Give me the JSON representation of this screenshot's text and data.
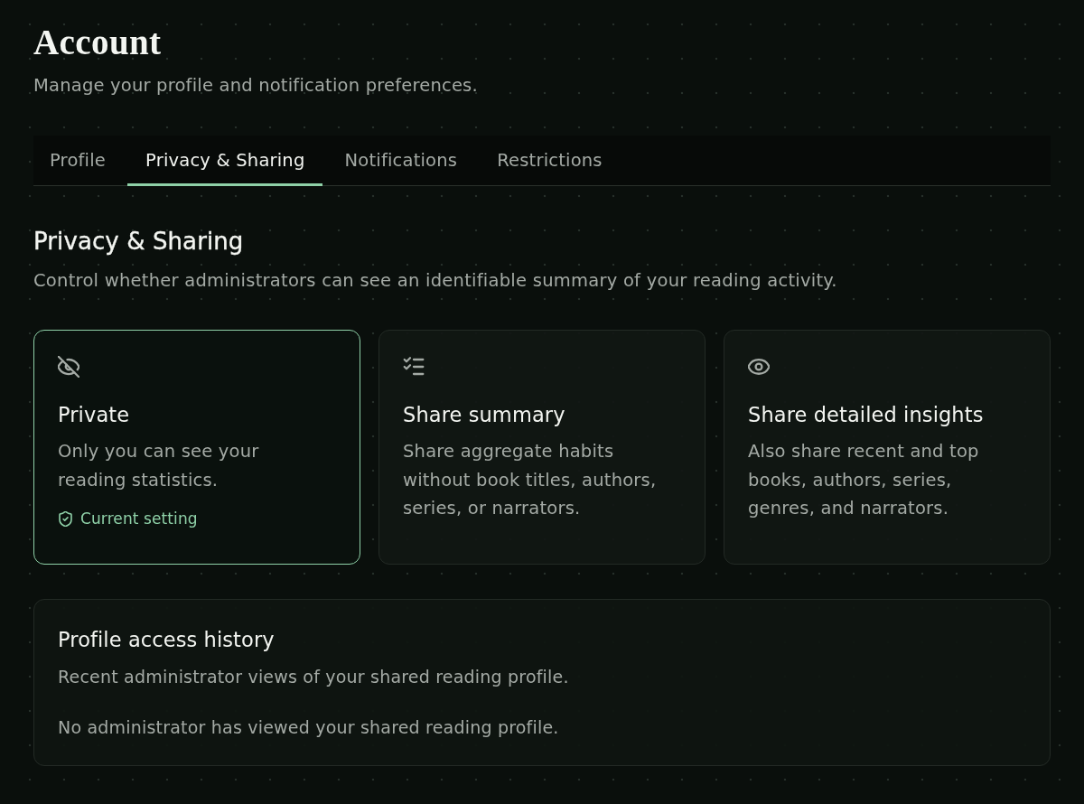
{
  "page": {
    "title": "Account",
    "subtitle": "Manage your profile and notification preferences."
  },
  "tabs": [
    {
      "label": "Profile",
      "selected": false
    },
    {
      "label": "Privacy & Sharing",
      "selected": true
    },
    {
      "label": "Notifications",
      "selected": false
    },
    {
      "label": "Restrictions",
      "selected": false
    }
  ],
  "section": {
    "title": "Privacy & Sharing",
    "description": "Control whether administrators can see an identifiable summary of your reading activity."
  },
  "options": [
    {
      "kind": "private",
      "title": "Private",
      "description": "Only you can see your reading statistics.",
      "selected": true,
      "badge": "Current setting"
    },
    {
      "kind": "summary",
      "title": "Share summary",
      "description": "Share aggregate habits without book titles, authors, series, or narrators.",
      "selected": false
    },
    {
      "kind": "detailed",
      "title": "Share detailed insights",
      "description": "Also share recent and top books, authors, series, genres, and narrators.",
      "selected": false
    }
  ],
  "history": {
    "title": "Profile access history",
    "description": "Recent administrator views of your shared reading profile.",
    "empty_message": "No administrator has viewed your shared reading profile."
  }
}
